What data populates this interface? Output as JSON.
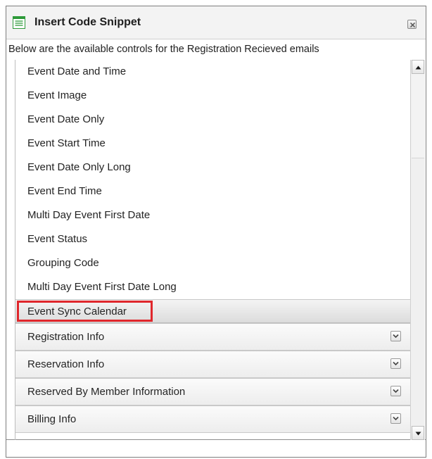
{
  "dialog": {
    "title": "Insert Code Snippet",
    "close_icon": "close-icon"
  },
  "description": "Below are the available controls for the Registration Recieved emails",
  "items": [
    {
      "label": "Event Date and Time"
    },
    {
      "label": "Event Image"
    },
    {
      "label": "Event Date Only"
    },
    {
      "label": "Event Start Time"
    },
    {
      "label": "Event Date Only Long"
    },
    {
      "label": "Event End Time"
    },
    {
      "label": "Multi Day Event First Date"
    },
    {
      "label": "Event Status"
    },
    {
      "label": "Grouping Code"
    },
    {
      "label": "Multi Day Event First Date Long"
    },
    {
      "label": "Event Sync Calendar",
      "selected": true
    }
  ],
  "sections": [
    {
      "label": "Registration Info",
      "icon": "chevron-down-icon"
    },
    {
      "label": "Reservation Info",
      "icon": "chevron-down-icon"
    },
    {
      "label": "Reserved By Member Information",
      "icon": "chevron-down-icon"
    },
    {
      "label": "Billing Info",
      "icon": "chevron-down-icon"
    }
  ],
  "colors": {
    "highlight": "#e0272c",
    "title_icon": "#2e9a3a"
  }
}
